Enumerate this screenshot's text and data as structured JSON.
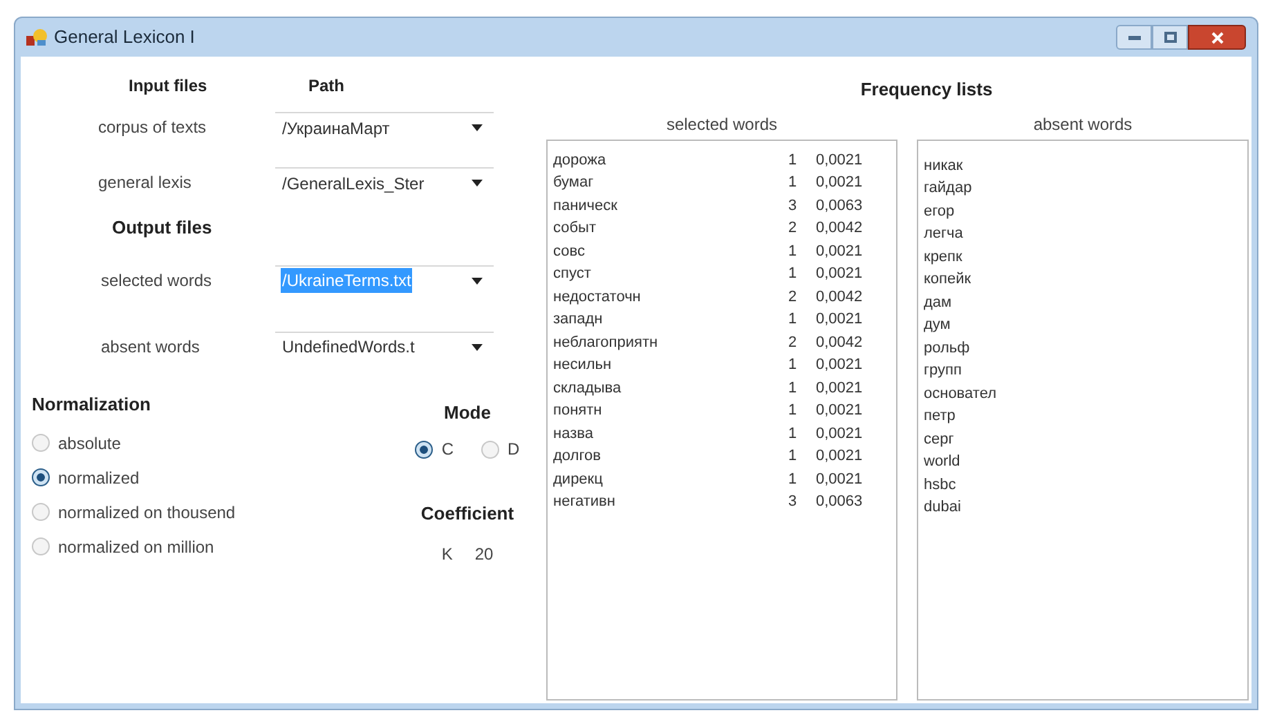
{
  "window": {
    "title": "General Lexicon I"
  },
  "input": {
    "heading": "Input files",
    "path_heading": "Path",
    "rows": [
      {
        "label": "corpus of texts",
        "value": "/УкраинаМарт",
        "highlighted": false
      },
      {
        "label": "general lexis",
        "value": "/GeneralLexis_Ster",
        "highlighted": false
      }
    ]
  },
  "output": {
    "heading": "Output files",
    "rows": [
      {
        "label": "selected words",
        "value": "/UkraineTerms.txt",
        "highlighted": true
      },
      {
        "label": "absent words",
        "value": "UndefinedWords.t",
        "highlighted": false
      }
    ]
  },
  "normalization": {
    "heading": "Normalization",
    "options": [
      {
        "label": "absolute",
        "selected": false
      },
      {
        "label": "normalized",
        "selected": true
      },
      {
        "label": "normalized on thousend",
        "selected": false
      },
      {
        "label": "normalized on million",
        "selected": false
      }
    ]
  },
  "mode": {
    "heading": "Mode",
    "options": [
      {
        "label": "C",
        "selected": true
      },
      {
        "label": "D",
        "selected": false
      }
    ]
  },
  "coefficient": {
    "heading": "Coefficient",
    "label": "K",
    "value": "20"
  },
  "frequency_lists": {
    "title": "Frequency lists",
    "selected_words": {
      "header": "selected words",
      "rows": [
        {
          "word": "дорожа",
          "count": "1",
          "freq": "0,0021"
        },
        {
          "word": "бумаг",
          "count": "1",
          "freq": "0,0021"
        },
        {
          "word": "паническ",
          "count": "3",
          "freq": "0,0063"
        },
        {
          "word": "событ",
          "count": "2",
          "freq": "0,0042"
        },
        {
          "word": "совс",
          "count": "1",
          "freq": "0,0021"
        },
        {
          "word": "спуст",
          "count": "1",
          "freq": "0,0021"
        },
        {
          "word": "недостаточн",
          "count": "2",
          "freq": "0,0042"
        },
        {
          "word": "западн",
          "count": "1",
          "freq": "0,0021"
        },
        {
          "word": "неблагоприятн",
          "count": "2",
          "freq": "0,0042"
        },
        {
          "word": "несильн",
          "count": "1",
          "freq": "0,0021"
        },
        {
          "word": "складыва",
          "count": "1",
          "freq": "0,0021"
        },
        {
          "word": "понятн",
          "count": "1",
          "freq": "0,0021"
        },
        {
          "word": "назва",
          "count": "1",
          "freq": "0,0021"
        },
        {
          "word": "долгов",
          "count": "1",
          "freq": "0,0021"
        },
        {
          "word": "дирекц",
          "count": "1",
          "freq": "0,0021"
        },
        {
          "word": "негативн",
          "count": "3",
          "freq": "0,0063"
        }
      ]
    },
    "absent_words": {
      "header": "absent words",
      "words": [
        "никак",
        "гайдар",
        "егор",
        "легча",
        "крепк",
        "копейк",
        "дам",
        "дум",
        "рольф",
        "групп",
        "основател",
        "петр",
        "серг",
        "world",
        "hsbc",
        "dubai"
      ]
    }
  }
}
